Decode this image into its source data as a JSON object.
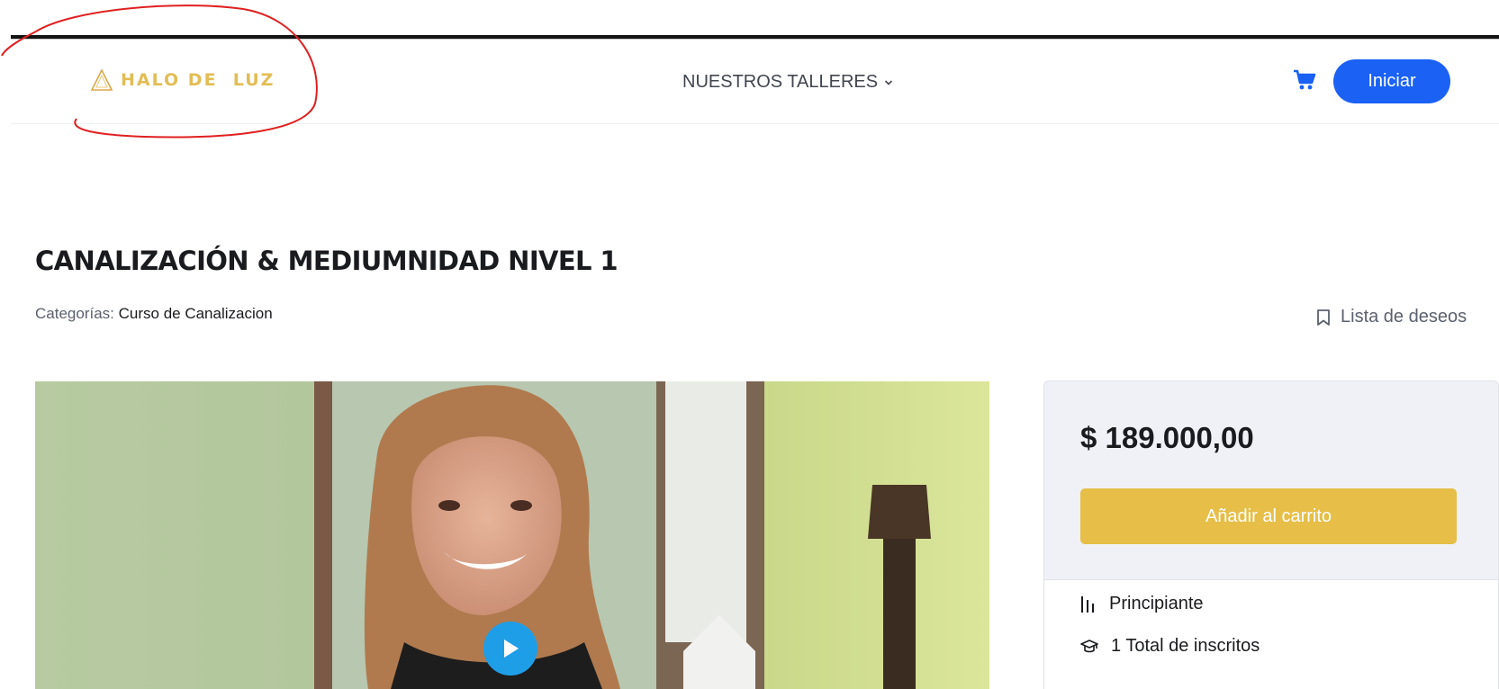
{
  "header": {
    "logo_text": "HALO DE  LUZ",
    "nav_item": "NUESTROS TALLERES",
    "login_label": "Iniciar"
  },
  "course": {
    "title": "CANALIZACIÓN & MEDIUMNIDAD NIVEL 1",
    "categories_label": "Categorías:",
    "category": "Curso de Canalizacion",
    "wishlist_label": "Lista de deseos"
  },
  "sidebar": {
    "price": "$ 189.000,00",
    "add_to_cart_label": "Añadir al carrito",
    "level": "Principiante",
    "enrolled": "1 Total de inscritos"
  },
  "colors": {
    "accent_blue": "#1a61f4",
    "gold": "#e6be48",
    "annotation_red": "#e02020",
    "play_button": "#1f9ee8"
  },
  "icons": [
    "triangle-logo-icon",
    "chevron-down-icon",
    "cart-icon",
    "bookmark-icon",
    "play-icon",
    "level-bars-icon",
    "graduation-cap-icon"
  ]
}
